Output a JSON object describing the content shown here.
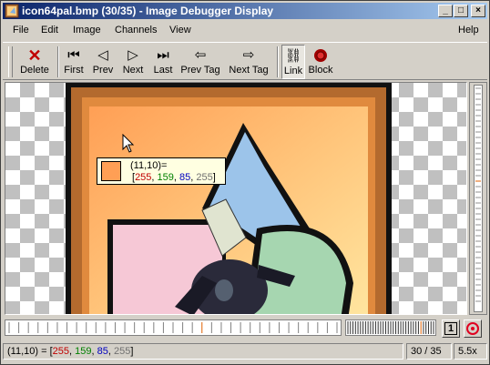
{
  "window": {
    "title": "icon64pal.bmp (30/35) - Image Debugger Display",
    "minimize": "_",
    "maximize": "□",
    "close": "×"
  },
  "menu": {
    "file": "File",
    "edit": "Edit",
    "image": "Image",
    "channels": "Channels",
    "view": "View",
    "help": "Help"
  },
  "toolbar": {
    "delete": "Delete",
    "first": "First",
    "prev": "Prev",
    "next": "Next",
    "last": "Last",
    "prev_tag": "Prev Tag",
    "next_tag": "Next Tag",
    "link": "Link",
    "block": "Block"
  },
  "tooltip": {
    "coord": "(11,10)=",
    "open": "[",
    "r": "255",
    "g": "159",
    "b": "85",
    "a": "255",
    "close": "]",
    "sep": ", ",
    "color": "#ff9f55"
  },
  "status": {
    "coord": "(11,10) = [",
    "r": "255",
    "g": "159",
    "b": "85",
    "a": "255",
    "close": "]",
    "sep": ", ",
    "frame": "30 / 35",
    "zoom": "5.5x"
  },
  "timeline": {
    "current_frame": 30,
    "total_frames": 35,
    "one_to_one_label": "1"
  }
}
